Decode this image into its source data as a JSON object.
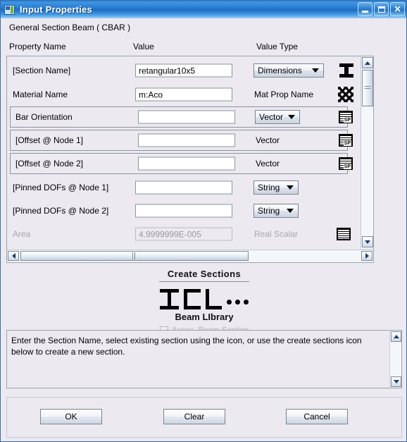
{
  "window": {
    "title": "Input Properties",
    "icon": "app-icon",
    "controls": {
      "minimize": "minimize",
      "maximize": "maximize",
      "close": "✕"
    }
  },
  "subtitle": "General Section Beam ( CBAR )",
  "columns": {
    "name": "Property Name",
    "value": "Value",
    "type": "Value Type"
  },
  "rows": [
    {
      "label": "[Section Name]",
      "value": "retangular10x5",
      "placeholder": "",
      "type_kind": "combo",
      "type_text": "Dimensions",
      "icon": "i-beam-icon",
      "framed": false,
      "disabled": false
    },
    {
      "label": "Material Name",
      "value": "m:Aco",
      "placeholder": "",
      "type_kind": "text",
      "type_text": "Mat Prop Name",
      "icon": "material-hatch-icon",
      "framed": false,
      "disabled": false
    },
    {
      "label": "Bar Orientation",
      "value": "",
      "placeholder": "",
      "type_kind": "combo",
      "type_text": "Vector",
      "icon": "spreadsheet-icon",
      "framed": true,
      "disabled": false
    },
    {
      "label": "[Offset @ Node 1]",
      "value": "",
      "placeholder": "",
      "type_kind": "text",
      "type_text": "Vector",
      "icon": "spreadsheet-icon",
      "framed": true,
      "disabled": false
    },
    {
      "label": "[Offset @ Node 2]",
      "value": "",
      "placeholder": "",
      "type_kind": "text",
      "type_text": "Vector",
      "icon": "spreadsheet-icon",
      "framed": true,
      "disabled": false
    },
    {
      "label": "[Pinned DOFs @ Node 1]",
      "value": "",
      "placeholder": "",
      "type_kind": "combo",
      "type_text": "String",
      "icon": "",
      "framed": false,
      "disabled": false
    },
    {
      "label": "[Pinned DOFs @ Node 2]",
      "value": "",
      "placeholder": "",
      "type_kind": "combo",
      "type_text": "String",
      "icon": "",
      "framed": false,
      "disabled": false
    },
    {
      "label": "Area",
      "value": "4.9999999E-005",
      "placeholder": "",
      "type_kind": "text",
      "type_text": "Real Scalar",
      "icon": "spreadsheet-icon",
      "framed": false,
      "disabled": true
    }
  ],
  "create_sections": {
    "title": "Create Sections",
    "subtitle": "Beam LIbrary",
    "shapes": [
      "I",
      "C",
      "L",
      "..."
    ],
    "checkbox": {
      "label": "Assoc. Beam Section",
      "checked": true,
      "enabled": false
    }
  },
  "help": {
    "text": "Enter the Section Name, select existing section using the icon, or use the create sections icon below to create a new section."
  },
  "footer": {
    "ok": "OK",
    "clear": "Clear",
    "cancel": "Cancel"
  },
  "colors": {
    "title_bar": "#2b7ed2",
    "dialog_bg": "#ece9f0",
    "field_bg": "#ffffff",
    "border": "#9aa5b1",
    "disabled_text": "#a9a9ad"
  }
}
